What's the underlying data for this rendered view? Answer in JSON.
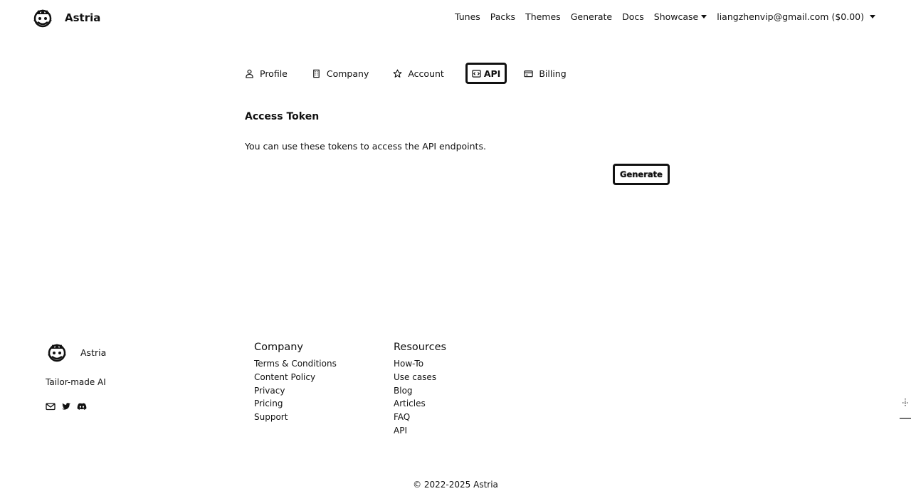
{
  "header": {
    "brand": "Astria",
    "nav": {
      "tunes": "Tunes",
      "packs": "Packs",
      "themes": "Themes",
      "generate": "Generate",
      "docs": "Docs",
      "showcase": "Showcase",
      "account": "liangzhenvip@gmail.com ($0.00)"
    }
  },
  "tabs": {
    "profile": "Profile",
    "company": "Company",
    "account": "Account",
    "api": "API",
    "billing": "Billing",
    "active": "API"
  },
  "main": {
    "title": "Access Token",
    "description": "You can use these tokens to access the API endpoints.",
    "generate_button": "Generate"
  },
  "footer": {
    "brand": "Astria",
    "tagline": "Tailor-made AI",
    "socials": [
      "mail-icon",
      "twitter-icon",
      "discord-icon"
    ],
    "company": {
      "heading": "Company",
      "links": [
        "Terms & Conditions",
        "Content Policy",
        "Privacy",
        "Pricing",
        "Support"
      ]
    },
    "resources": {
      "heading": "Resources",
      "links": [
        "How-To",
        "Use cases",
        "Blog",
        "Articles",
        "FAQ",
        "API"
      ]
    },
    "copyright": "© 2022-2025 Astria"
  },
  "colors": {
    "text": "#111111",
    "background": "#ffffff"
  }
}
